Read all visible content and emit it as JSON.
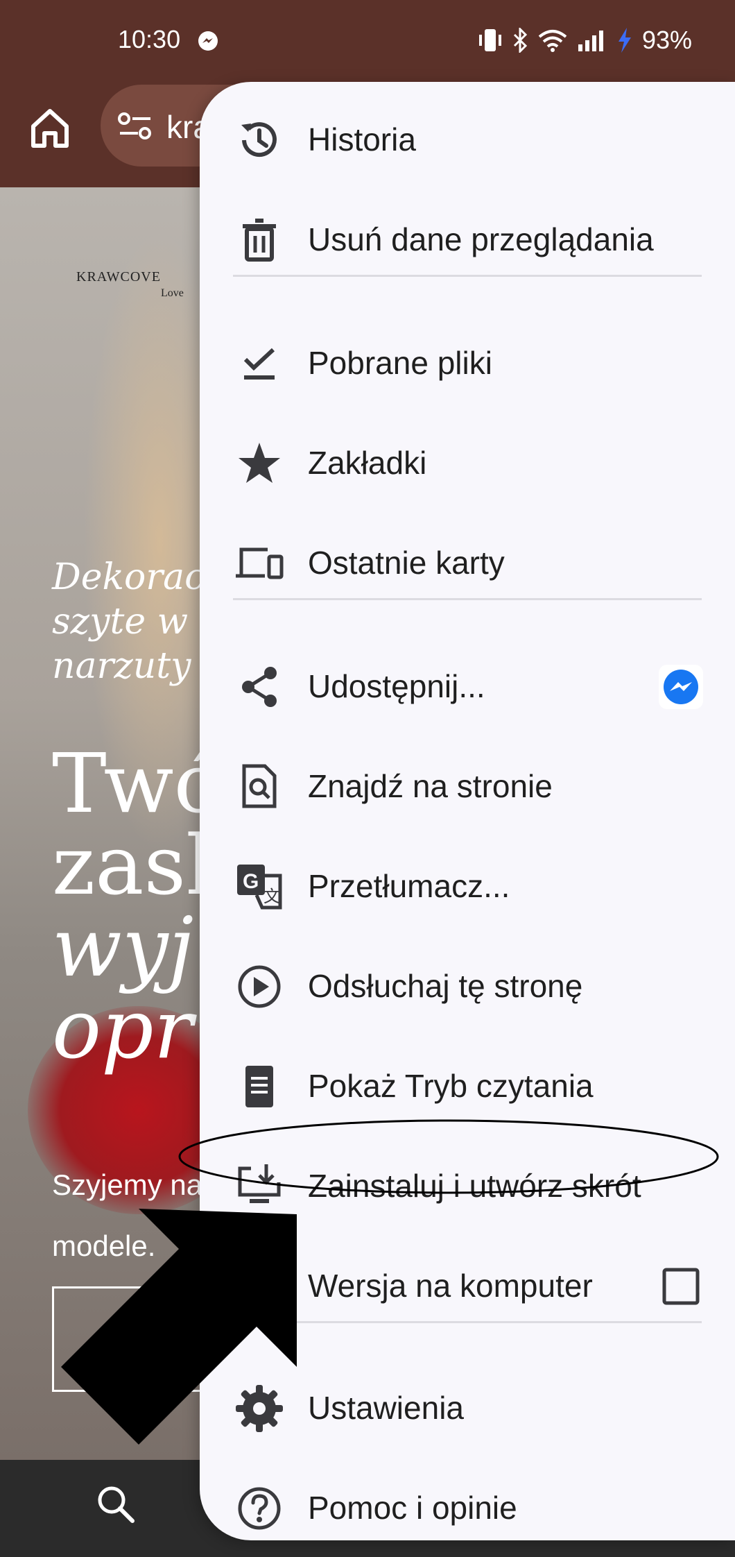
{
  "status_bar": {
    "time": "10:30",
    "battery": "93%"
  },
  "toolbar": {
    "url_text": "kra"
  },
  "page": {
    "logo": {
      "brand": "KRAWCOVE",
      "sub": "Love"
    },
    "hero_small_lines": [
      "Dekorac",
      "szyte w",
      "narzuty"
    ],
    "hero_big_lines": [
      "Twó",
      "zask",
      "wyjq",
      "opr"
    ],
    "body_lines": [
      "Szyjemy na",
      "modele."
    ]
  },
  "menu": {
    "items": [
      {
        "label": "Historia",
        "icon": "history-icon"
      },
      {
        "label": "Usuń dane przeglądania",
        "icon": "trash-icon"
      },
      {
        "label": "Pobrane pliki",
        "icon": "download-check-icon"
      },
      {
        "label": "Zakładki",
        "icon": "star-icon"
      },
      {
        "label": "Ostatnie karty",
        "icon": "devices-icon"
      },
      {
        "label": "Udostępnij...",
        "icon": "share-icon"
      },
      {
        "label": "Znajdź na stronie",
        "icon": "find-in-page-icon"
      },
      {
        "label": "Przetłumacz...",
        "icon": "translate-icon"
      },
      {
        "label": "Odsłuchaj tę stronę",
        "icon": "play-circle-icon"
      },
      {
        "label": "Pokaż Tryb czytania",
        "icon": "reader-mode-icon"
      },
      {
        "label": "Zainstaluj i utwórz skrót",
        "icon": "install-app-icon"
      },
      {
        "label": "Wersja na komputer",
        "icon": "desktop-icon"
      },
      {
        "label": "Ustawienia",
        "icon": "gear-icon"
      },
      {
        "label": "Pomoc i opinie",
        "icon": "help-icon"
      }
    ],
    "desktop_version_checked": false
  },
  "colors": {
    "toolbar": "#5b3129",
    "menu_bg": "#f8f7fc",
    "messenger": "#1877f2"
  }
}
